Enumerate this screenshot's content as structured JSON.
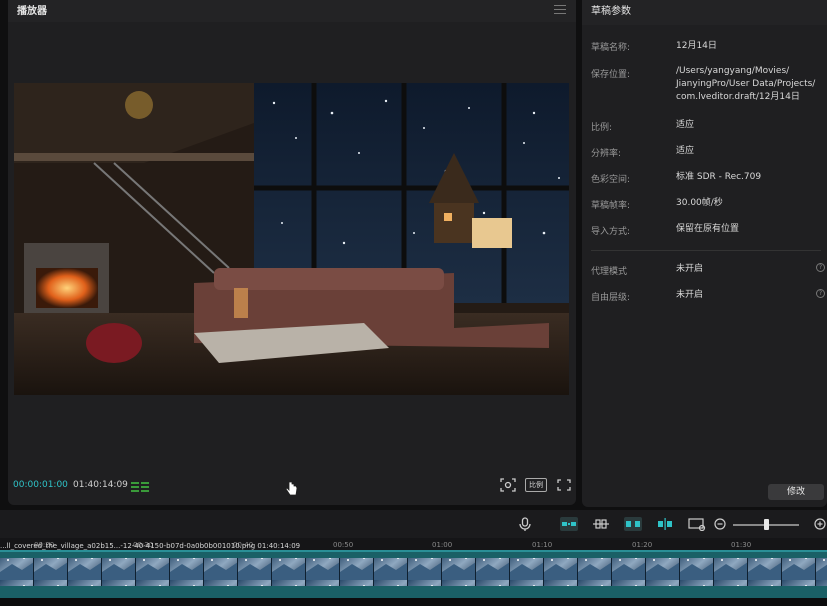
{
  "player": {
    "title": "播放器",
    "timecode_current": "00:00:01:00",
    "timecode_total": "01:40:14:09",
    "ratio_label": "比例"
  },
  "params": {
    "title": "草稿参数",
    "rows": [
      {
        "label": "草稿名称:",
        "value": "12月14日"
      },
      {
        "label": "保存位置:",
        "value_lines": [
          "/Users/yangyang/Movies/",
          "JianyingPro/User Data/Projects/",
          "com.lveditor.draft/12月14日"
        ]
      },
      {
        "label": "比例:",
        "value": "适应"
      },
      {
        "label": "分辨率:",
        "value": "适应"
      },
      {
        "label": "色彩空间:",
        "value": "标准 SDR - Rec.709"
      },
      {
        "label": "草稿帧率:",
        "value": "30.00帧/秒"
      },
      {
        "label": "导入方式:",
        "value": "保留在原有位置"
      },
      {
        "label": "代理模式",
        "value": "未开启"
      },
      {
        "label": "自由层级:",
        "value": "未开启"
      }
    ],
    "edit_button": "修改"
  },
  "timeline": {
    "ruler_ticks": [
      "00:20",
      "00:30",
      "00:40",
      "00:50",
      "01:00",
      "01:10",
      "01:20",
      "01:30"
    ],
    "clip_label": "...ll_covered_the_village_a02b15...-12-40-4150-b07d-0a0b0b001010.png 01:40:14:09"
  },
  "colors": {
    "accent": "#2fc3c8",
    "panel": "#1f1f21",
    "track": "#1a6066"
  }
}
